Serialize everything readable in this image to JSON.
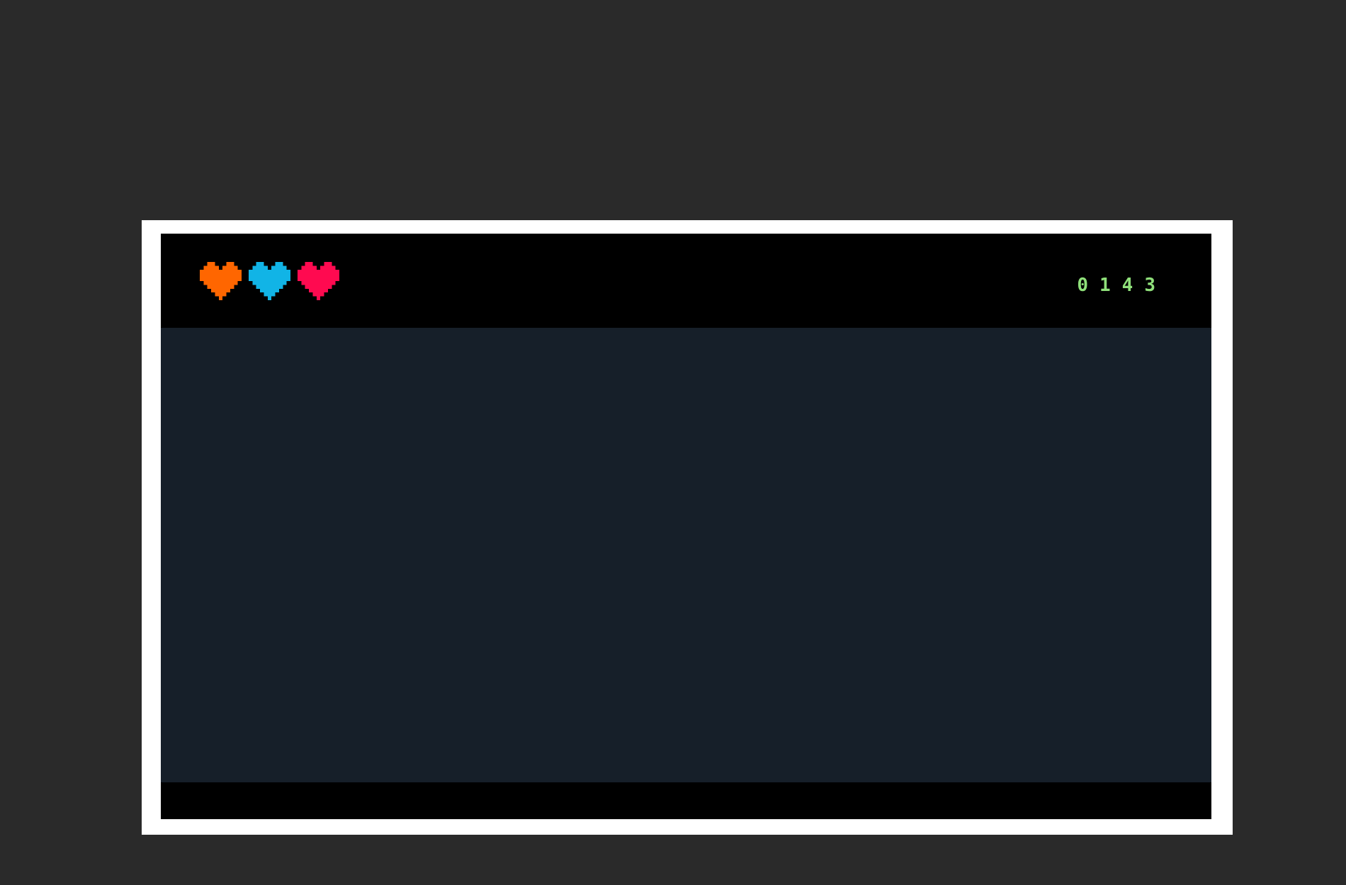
{
  "hud": {
    "hearts": [
      {
        "icon": "heart-icon",
        "color": "#ff6600"
      },
      {
        "icon": "heart-icon",
        "color": "#11b4e6"
      },
      {
        "icon": "heart-icon",
        "color": "#ff0a50"
      }
    ],
    "score": "0143"
  }
}
